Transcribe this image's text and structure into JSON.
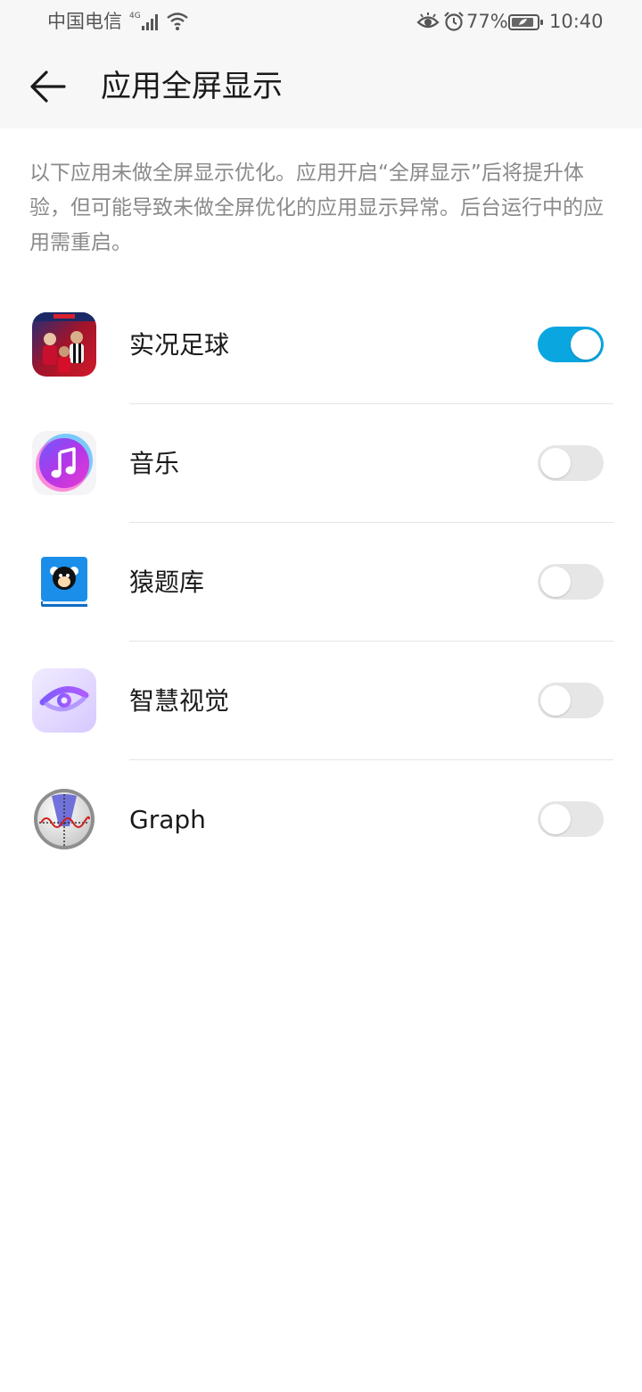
{
  "status_bar": {
    "carrier": "中国电信",
    "network": "4G",
    "battery_percent": "77%",
    "time": "10:40",
    "icons": [
      "signal-icon",
      "wifi-icon",
      "eye-comfort-icon",
      "alarm-icon",
      "battery-icon"
    ]
  },
  "header": {
    "title": "应用全屏显示",
    "back_icon": "arrow-left-icon"
  },
  "description": "以下应用未做全屏显示优化。应用开启“全屏显示”后将提升体验，但可能导致未做全屏优化的应用显示异常。后台运行中的应用需重启。",
  "apps": [
    {
      "name": "实况足球",
      "icon": "soccer-game-icon",
      "enabled": true
    },
    {
      "name": "音乐",
      "icon": "music-icon",
      "enabled": false
    },
    {
      "name": "猿题库",
      "icon": "yuantiku-icon",
      "enabled": false
    },
    {
      "name": "智慧视觉",
      "icon": "ai-vision-icon",
      "enabled": false
    },
    {
      "name": "Graph",
      "icon": "graph-icon",
      "enabled": false
    }
  ],
  "colors": {
    "accent": "#0aa6e0",
    "toggle_off": "#e6e6e6",
    "header_bg": "#f7f7f7",
    "secondary_text": "#8a8a8a"
  }
}
